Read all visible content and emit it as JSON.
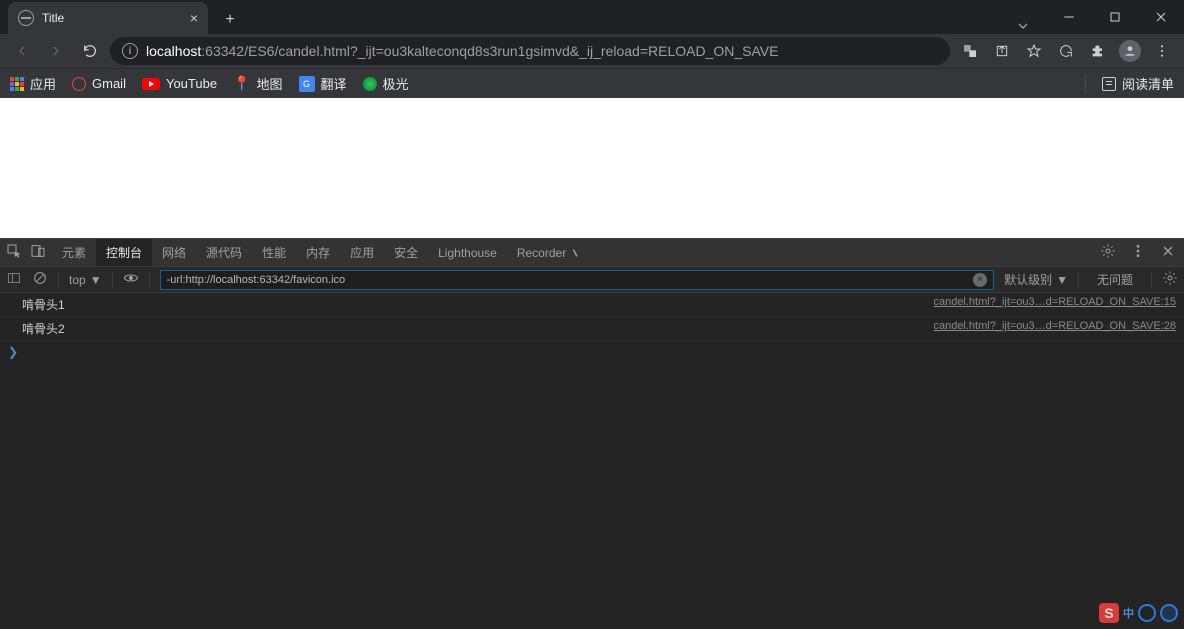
{
  "browser": {
    "tab_title": "Title",
    "url_host": "localhost",
    "url_path": ":63342/ES6/candel.html?_ijt=ou3kalteconqd8s3run1gsimvd&_ij_reload=RELOAD_ON_SAVE"
  },
  "bookmarks": {
    "apps": "应用",
    "gmail": "Gmail",
    "youtube": "YouTube",
    "maps": "地图",
    "translate": "翻译",
    "polar": "极光",
    "reading_list": "阅读清单"
  },
  "devtools": {
    "tabs": {
      "elements": "元素",
      "console": "控制台",
      "network": "网络",
      "sources": "源代码",
      "performance": "性能",
      "memory": "内存",
      "application": "应用",
      "security": "安全",
      "lighthouse": "Lighthouse",
      "recorder": "Recorder"
    },
    "toolbar": {
      "context": "top",
      "filter_value": "-url:http://localhost:63342/favicon.ico",
      "log_level": "默认级别",
      "issues": "无问题"
    },
    "logs": [
      {
        "msg": "啃骨头1",
        "src": "candel.html?_ijt=ou3…d=RELOAD_ON_SAVE:15"
      },
      {
        "msg": "啃骨头2",
        "src": "candel.html?_ijt=ou3…d=RELOAD_ON_SAVE:28"
      }
    ]
  }
}
